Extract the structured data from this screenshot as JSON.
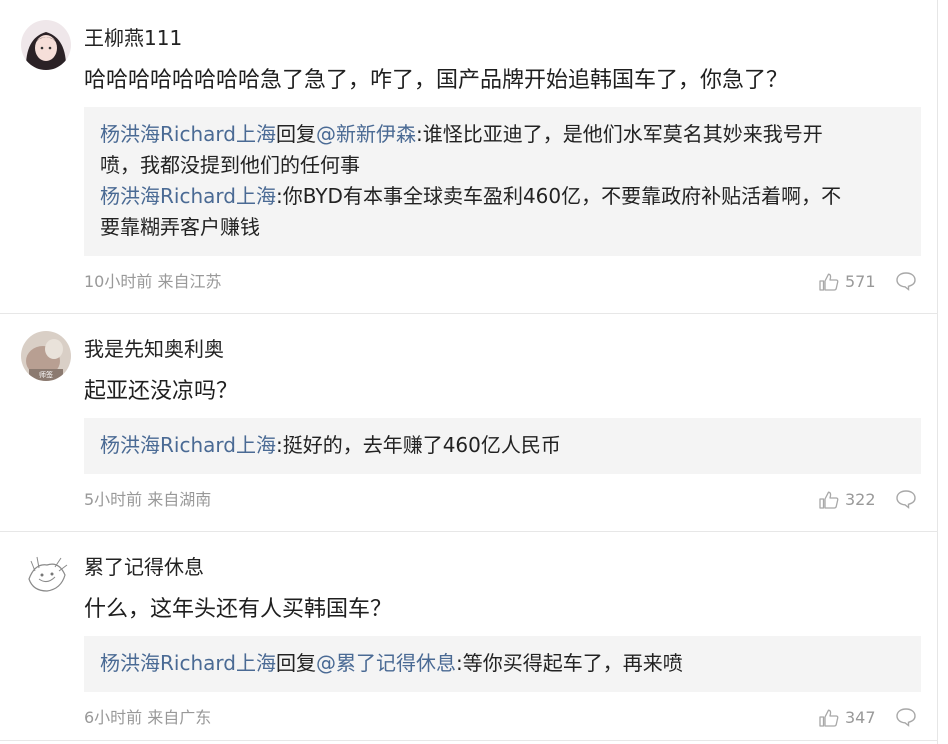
{
  "comments": [
    {
      "username": "王柳燕111",
      "text": "哈哈哈哈哈哈哈哈急了急了，咋了，国产品牌开始追韩国车了，你急了？",
      "replies": [
        {
          "name": "杨洪海Richard上海",
          "conn": "回复",
          "target": "@新新伊森",
          "sep": ":",
          "text": "谁怪比亚迪了，是他们水军莫名其妙来我号开",
          "cont": "喷，我都没提到他们的任何事"
        },
        {
          "name": "杨洪海Richard上海",
          "conn": "",
          "target": "",
          "sep": ":",
          "text": "你BYD有本事全球卖车盈利460亿，不要靠政府补贴活着啊，不",
          "cont": "要靠糊弄客户赚钱"
        }
      ],
      "meta": "10小时前 来自江苏",
      "likes": "571"
    },
    {
      "username": "我是先知奥利奥",
      "text": "起亚还没凉吗？",
      "replies": [
        {
          "name": "杨洪海Richard上海",
          "conn": "",
          "target": "",
          "sep": ":",
          "text": "挺好的，去年赚了460亿人民币",
          "cont": ""
        }
      ],
      "meta": "5小时前 来自湖南",
      "likes": "322"
    },
    {
      "username": "累了记得休息",
      "text": "什么，这年头还有人买韩国车？",
      "replies": [
        {
          "name": "杨洪海Richard上海",
          "conn": "回复",
          "target": "@累了记得休息",
          "sep": ":",
          "text": "等你买得起车了，再来喷",
          "cont": ""
        }
      ],
      "meta": "6小时前 来自广东",
      "likes": "347"
    }
  ],
  "icons": {
    "like": "thumbs-up-icon",
    "reply": "speech-bubble-icon"
  },
  "colors": {
    "name_link": "#4a6a94",
    "reply_bg": "#f4f4f4",
    "meta": "#999999"
  }
}
